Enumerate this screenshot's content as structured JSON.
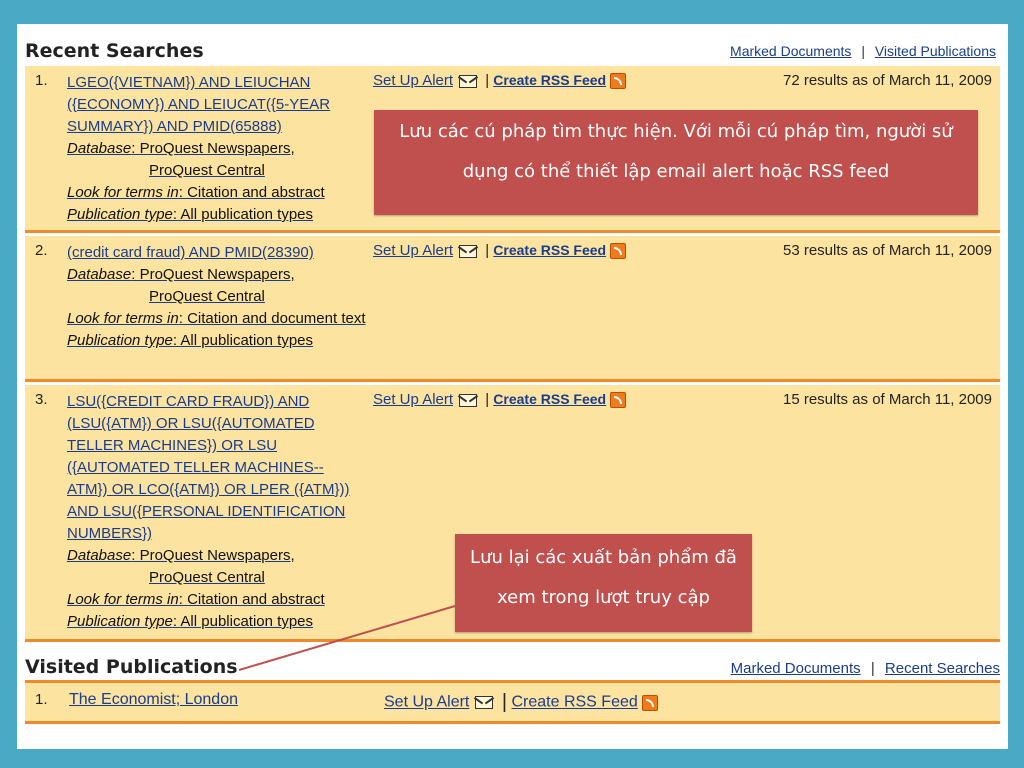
{
  "recent": {
    "title": "Recent Searches",
    "link_marked": "Marked Documents",
    "sep": "|",
    "link_visited": "Visited Publications",
    "alert_label": "Set Up Alert",
    "rss_label": "Create RSS Feed",
    "db_label": "Database",
    "look_label": "Look for terms in",
    "pub_label": "Publication type",
    "pub_value": "All publication types",
    "items": [
      {
        "num": "1.",
        "query": "LGEO({VIETNAM}) AND LEIUCHAN ({ECONOMY}) AND LEIUCAT({5-YEAR SUMMARY}) AND PMID(65888)",
        "db1": "ProQuest Newspapers,",
        "db2": "ProQuest Central",
        "look": "Citation and abstract",
        "results": "72 results as of March 11, 2009"
      },
      {
        "num": "2.",
        "query": "(credit card fraud) AND PMID(28390)",
        "db1": "ProQuest Newspapers,",
        "db2": "ProQuest Central",
        "look": "Citation and document text",
        "results": "53 results as of March 11, 2009"
      },
      {
        "num": "3.",
        "query": "LSU({CREDIT CARD FRAUD}) AND (LSU({ATM}) OR LSU({AUTOMATED TELLER MACHINES}) OR LSU ({AUTOMATED TELLER MACHINES--ATM}) OR LCO({ATM}) OR LPER ({ATM})) AND LSU({PERSONAL IDENTIFICATION NUMBERS})",
        "db1": "ProQuest Newspapers,",
        "db2": "ProQuest Central",
        "look": "Citation and abstract",
        "results": "15 results as of March 11, 2009"
      }
    ]
  },
  "visited": {
    "title": "Visited Publications",
    "link_marked": "Marked Documents",
    "sep": "|",
    "link_recent": "Recent Searches",
    "items": [
      {
        "num": "1.",
        "name": "The Economist; London"
      }
    ]
  },
  "callouts": {
    "top": "Lưu các cú pháp tìm thực hiện. Với mỗi cú pháp tìm, người sử dụng có thể thiết lập email alert hoặc RSS feed",
    "bottom": "Lưu lại các xuất bản phẩm đã xem trong lượt truy cập"
  },
  "colors": {
    "background": "#4aa9c4",
    "row_fill": "#fde3a0",
    "row_border": "#f0892b",
    "callout": "#c0504d",
    "link": "#1a3c8c"
  }
}
